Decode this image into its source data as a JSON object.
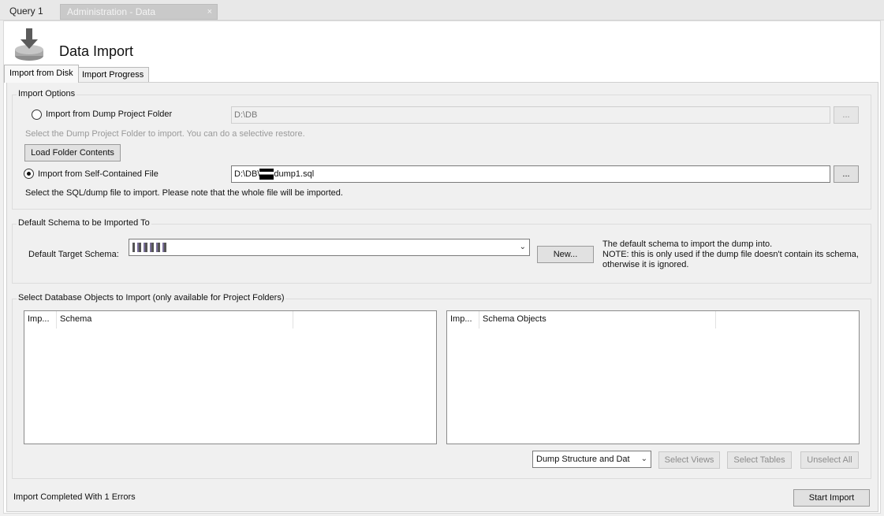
{
  "doc_tabs": {
    "query_tab": "Query 1",
    "admin_tab": "Administration - Data Import/Res...",
    "close_glyph": "×"
  },
  "header": {
    "title": "Data Import"
  },
  "tabs": {
    "import_from_disk": "Import from Disk",
    "import_progress": "Import Progress"
  },
  "import_options": {
    "legend": "Import Options",
    "dump_folder_radio": "Import from Dump Project Folder",
    "dump_folder_path": "D:\\DB",
    "dump_folder_hint": "Select the Dump Project Folder to import. You can do a selective restore.",
    "browse_label": "...",
    "load_folder_button": "Load Folder Contents",
    "self_contained_radio": "Import from Self-Contained File",
    "self_contained_path_prefix": "D:\\DB\\",
    "self_contained_path_suffix": "dump1.sql",
    "self_contained_hint": "Select the SQL/dump file to import. Please note that the whole file will be imported.",
    "selected": "self_contained"
  },
  "default_schema": {
    "legend": "Default Schema to be Imported To",
    "target_label": "Default Target Schema:",
    "new_button": "New...",
    "note_line1": "The default schema to import the dump into.",
    "note_line2": "NOTE: this is only used if the dump file doesn't contain its schema,",
    "note_line3": "otherwise it is ignored."
  },
  "objects": {
    "legend": "Select Database Objects to Import (only available for Project Folders)",
    "left_columns": [
      "Imp...",
      "Schema"
    ],
    "right_columns": [
      "Imp...",
      "Schema Objects"
    ],
    "dump_mode_value": "Dump Structure and Dat",
    "select_views": "Select Views",
    "select_tables": "Select Tables",
    "unselect_all": "Unselect All"
  },
  "footer": {
    "status": "Import Completed With 1 Errors",
    "start_import": "Start Import"
  }
}
